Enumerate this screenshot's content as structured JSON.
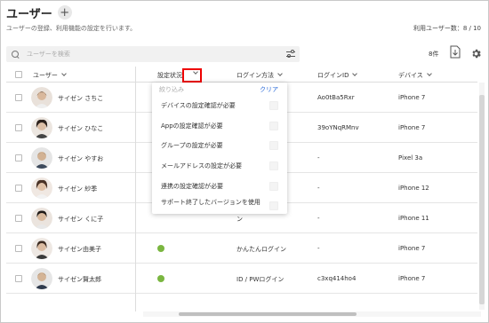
{
  "header": {
    "title": "ユーザー",
    "add_label": "+",
    "subtitle": "ユーザーの登録、利用機能の設定を行います。",
    "user_count": "利用ユーザー数：8 / 10"
  },
  "search": {
    "placeholder": "ユーザーを検索"
  },
  "toolbar": {
    "count": "8件"
  },
  "columns": [
    "ユーザー",
    "設定状況",
    "ログイン方法",
    "ログインID",
    "デバイス"
  ],
  "rows": [
    {
      "name": "サイゼン さちこ",
      "login": "",
      "login_id": "Ao0tBa5Rxr",
      "device": "iPhone 7"
    },
    {
      "name": "サイゼン ひなこ",
      "login": "",
      "login_id": "39oYNqRMnv",
      "device": "iPhone 7"
    },
    {
      "name": "サイゼン やすお",
      "login": "ン",
      "login_id": "-",
      "device": "Pixel 3a"
    },
    {
      "name": "サイゼン 紗季",
      "login": "ン",
      "login_id": "-",
      "device": "iPhone 12"
    },
    {
      "name": "サイゼン くに子",
      "login": "ン",
      "login_id": "-",
      "device": "iPhone 11"
    },
    {
      "name": "サイゼン由美子",
      "login": "かんたんログイン",
      "login_id": "-",
      "device": "iPhone 7"
    },
    {
      "name": "サイゼン賢太郎",
      "login": "ID / PWログイン",
      "login_id": "c3xq414ho4",
      "device": "iPhone 7"
    }
  ],
  "dropdown": {
    "placeholder": "絞り込み",
    "clear_label": "クリア",
    "items": [
      "デバイスの設定確認が必要",
      "Appの設定確認が必要",
      "グループの設定が必要",
      "メールアドレスの設定が必要",
      "連携の設定確認が必要",
      "サポート終了したバージョンを使用"
    ]
  },
  "colors": {
    "accent": "#2a6ad9",
    "status_ok": "#7ab640",
    "highlight": "#e00000"
  }
}
